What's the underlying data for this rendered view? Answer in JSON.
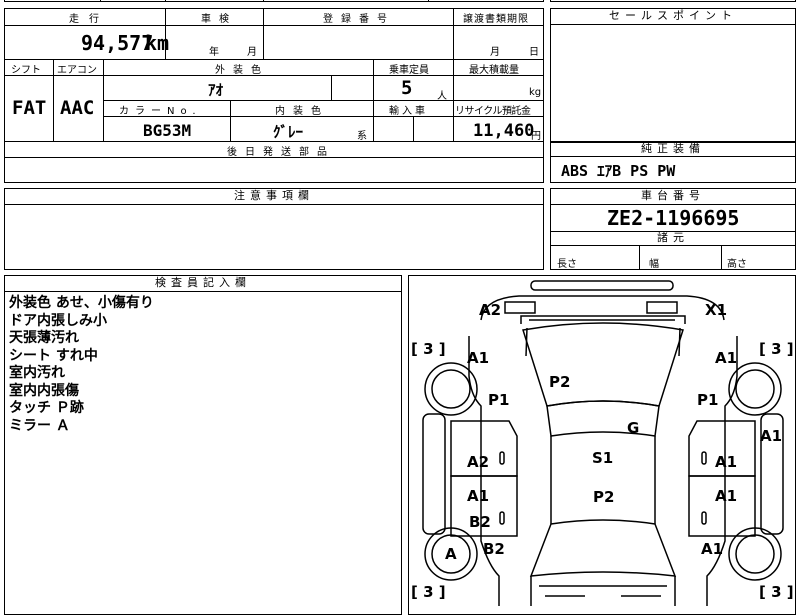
{
  "vehicle": {
    "mileage_label": "走行",
    "mileage_value": "94,577",
    "mileage_unit": "km",
    "inspection_label": "車検",
    "inspection_year_unit": "年",
    "inspection_month_unit": "月",
    "registration_label": "登録番号",
    "transfer_label": "譲渡書類期限",
    "transfer_month_unit": "月",
    "transfer_day_unit": "日",
    "shift_label": "シフト",
    "shift_value": "FAT",
    "aircon_label": "エアコン",
    "aircon_value": "AAC",
    "exterior_color_label": "外装色",
    "exterior_color_value": "ｱｵ",
    "capacity_label": "乗車定員",
    "capacity_value": "5",
    "capacity_unit": "人",
    "max_load_label": "最大積載量",
    "max_load_unit": "kg",
    "color_no_label": "カラーNo.",
    "color_no_value": "BG53M",
    "interior_color_label": "内装色",
    "interior_color_value": "ｸﾞﾚｰ",
    "interior_color_unit": "系",
    "import_label": "輸入車",
    "recycle_label": "リサイクル預託金",
    "recycle_value": "11,460",
    "recycle_unit": "円",
    "parts_label": "後日発送部品"
  },
  "right_panel": {
    "sales_point_label": "セールスポイント",
    "equipment_label": "純正装備",
    "equipment_value": "ABS ｴｱB PS PW",
    "chassis_label": "車台番号",
    "chassis_value": "ZE2-1196695",
    "dimensions_label": "諸元",
    "length_label": "長さ",
    "width_label": "幅",
    "height_label": "高さ"
  },
  "notes": {
    "caution_label": "注意事項欄",
    "inspector_label": "検査員記入欄",
    "inspector_lines": [
      "外装色 あせ、小傷有り",
      "ドア内張しみ小",
      "天張薄汚れ",
      "シート すれ中",
      "室内汚れ",
      "室内内張傷",
      "タッチ Ｐ跡",
      "ミラー Ａ"
    ]
  },
  "diagram": {
    "tread_marks": [
      "[ 3 ]",
      "[ 3 ]",
      "[ 3 ]",
      "[ 3 ]"
    ],
    "damage_marks": [
      "A2",
      "X1",
      "A1",
      "A1",
      "P2",
      "P1",
      "P1",
      "G",
      "A1",
      "A2",
      "S1",
      "A1",
      "A1",
      "P2",
      "A1",
      "B2",
      "B2",
      "A1",
      "A"
    ]
  }
}
